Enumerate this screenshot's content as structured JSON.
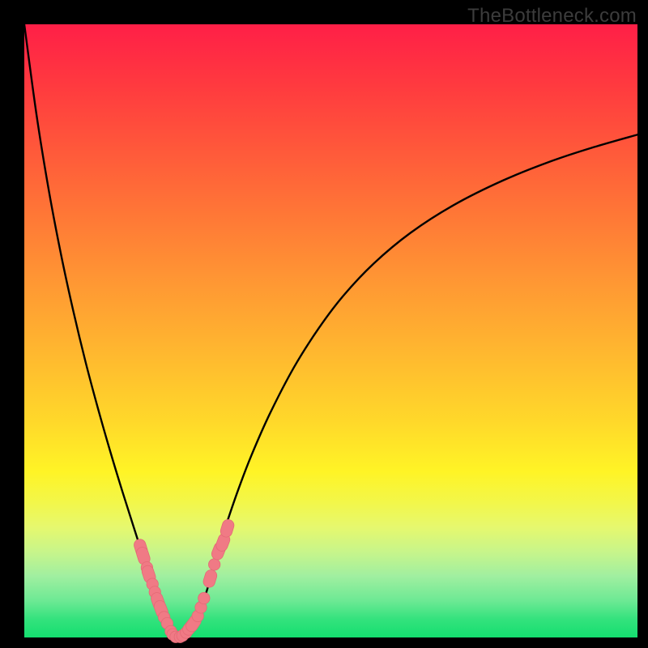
{
  "watermark": "TheBottleneck.com",
  "colors": {
    "background": "#000000",
    "curve": "#000000",
    "marker_fill": "#f07a85",
    "marker_stroke": "#e46a76",
    "gradient_top": "#ff1f47",
    "gradient_bottom": "#14df6f"
  },
  "chart_data": {
    "type": "line",
    "title": "",
    "xlabel": "",
    "ylabel": "",
    "xlim": [
      0,
      100
    ],
    "ylim": [
      0,
      100
    ],
    "grid": false,
    "series": [
      {
        "name": "left-curve",
        "x": [
          0,
          2,
          4,
          6,
          8,
          10,
          12,
          14,
          16,
          18,
          19,
          20,
          21,
          22,
          23,
          23.6,
          24,
          24.4,
          25
        ],
        "y": [
          100,
          85.2,
          72.9,
          62.4,
          53.2,
          44.9,
          37.4,
          30.4,
          23.8,
          17.5,
          14.4,
          11.4,
          8.4,
          5.5,
          2.6,
          1.1,
          0.5,
          0.2,
          0
        ]
      },
      {
        "name": "right-curve",
        "x": [
          25,
          25.4,
          26,
          27,
          28,
          29,
          30,
          31,
          32,
          33.5,
          35,
          37,
          40,
          44,
          48,
          52,
          57,
          63,
          70,
          78,
          86,
          93,
          100
        ],
        "y": [
          0,
          0.1,
          0.4,
          1.3,
          2.9,
          5.3,
          8.4,
          12.0,
          15.5,
          20.1,
          24.4,
          29.6,
          36.4,
          44.1,
          50.4,
          55.7,
          61.0,
          66.0,
          70.5,
          74.5,
          77.7,
          80.0,
          82.0
        ]
      }
    ],
    "markers": {
      "name": "dots",
      "shape": "pill-round",
      "x": [
        19.0,
        19.4,
        20.0,
        20.3,
        20.9,
        21.3,
        21.8,
        22.3,
        22.8,
        23.3,
        23.9,
        24.2,
        24.7,
        25.4,
        25.8,
        26.4,
        27.1,
        27.6,
        28.3,
        28.8,
        29.3,
        30.3,
        31.0,
        31.7,
        32.4,
        33.1
      ],
      "y": [
        14.6,
        13.3,
        11.4,
        10.3,
        8.7,
        7.4,
        5.9,
        4.6,
        3.3,
        2.3,
        1.0,
        0.5,
        0.1,
        0.1,
        0.3,
        0.8,
        1.7,
        2.3,
        3.5,
        4.9,
        6.4,
        9.6,
        11.9,
        14.1,
        15.5,
        17.8
      ],
      "elongated_indices": [
        0,
        1,
        3,
        6,
        7,
        16,
        17,
        21,
        23,
        24,
        25
      ]
    }
  }
}
